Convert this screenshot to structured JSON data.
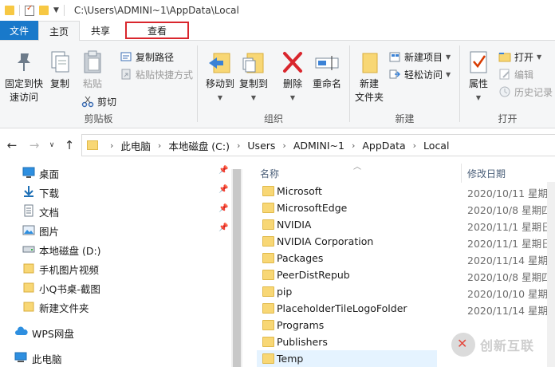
{
  "window": {
    "title": "C:\\Users\\ADMINI~1\\AppData\\Local"
  },
  "tabs": {
    "file": "文件",
    "home": "主页",
    "share": "共享",
    "view": "查看"
  },
  "ribbon": {
    "clipboard": {
      "label": "剪贴板",
      "pin_quick_access": "固定到快\n速访问",
      "copy": "复制",
      "paste": "粘贴",
      "copy_path": "复制路径",
      "paste_shortcut": "粘贴快捷方式",
      "cut": "剪切"
    },
    "organize": {
      "label": "组织",
      "move_to": "移动到",
      "copy_to": "复制到",
      "delete": "删除",
      "rename": "重命名"
    },
    "new": {
      "label": "新建",
      "new_folder": "新建\n文件夹",
      "new_item": "新建项目",
      "easy_access": "轻松访问"
    },
    "open": {
      "label": "打开",
      "properties": "属性",
      "open": "打开",
      "edit": "编辑",
      "history": "历史记录"
    }
  },
  "breadcrumb": [
    "此电脑",
    "本地磁盘 (C:)",
    "Users",
    "ADMINI~1",
    "AppData",
    "Local"
  ],
  "nav_pane": [
    {
      "label": "桌面",
      "icon": "desktop-icon",
      "pinned": true
    },
    {
      "label": "下载",
      "icon": "download-icon",
      "pinned": true
    },
    {
      "label": "文档",
      "icon": "document-icon",
      "pinned": true
    },
    {
      "label": "图片",
      "icon": "picture-icon",
      "pinned": true
    },
    {
      "label": "本地磁盘 (D:)",
      "icon": "drive-icon",
      "pinned": false
    },
    {
      "label": "手机图片视频",
      "icon": "folder-icon",
      "pinned": false
    },
    {
      "label": "小Q书桌-截图",
      "icon": "folder-icon",
      "pinned": false
    },
    {
      "label": "新建文件夹",
      "icon": "folder-icon",
      "pinned": false
    },
    {
      "label": "WPS网盘",
      "icon": "cloud-icon",
      "pinned": false
    },
    {
      "label": "此电脑",
      "icon": "computer-icon",
      "pinned": false
    }
  ],
  "file_list": {
    "columns": {
      "name": "名称",
      "modified": "修改日期"
    },
    "rows": [
      {
        "name": "Microsoft",
        "date": "2020/10/11 星期日"
      },
      {
        "name": "MicrosoftEdge",
        "date": "2020/10/8 星期四 1"
      },
      {
        "name": "NVIDIA",
        "date": "2020/11/1 星期日 1"
      },
      {
        "name": "NVIDIA Corporation",
        "date": "2020/11/1 星期日 1"
      },
      {
        "name": "Packages",
        "date": "2020/11/14 星期六"
      },
      {
        "name": "PeerDistRepub",
        "date": "2020/10/8 星期四 1"
      },
      {
        "name": "pip",
        "date": "2020/10/10 星期六"
      },
      {
        "name": "PlaceholderTileLogoFolder",
        "date": "2020/11/14 星期六"
      },
      {
        "name": "Programs",
        "date": ""
      },
      {
        "name": "Publishers",
        "date": ""
      },
      {
        "name": "Temp",
        "date": ""
      }
    ]
  },
  "watermark": {
    "text": "创新互联"
  },
  "colors": {
    "file_tab": "#1979ca",
    "highlight_border": "#d9262d",
    "selection": "#e5f3ff",
    "folder": "#f8d775"
  }
}
